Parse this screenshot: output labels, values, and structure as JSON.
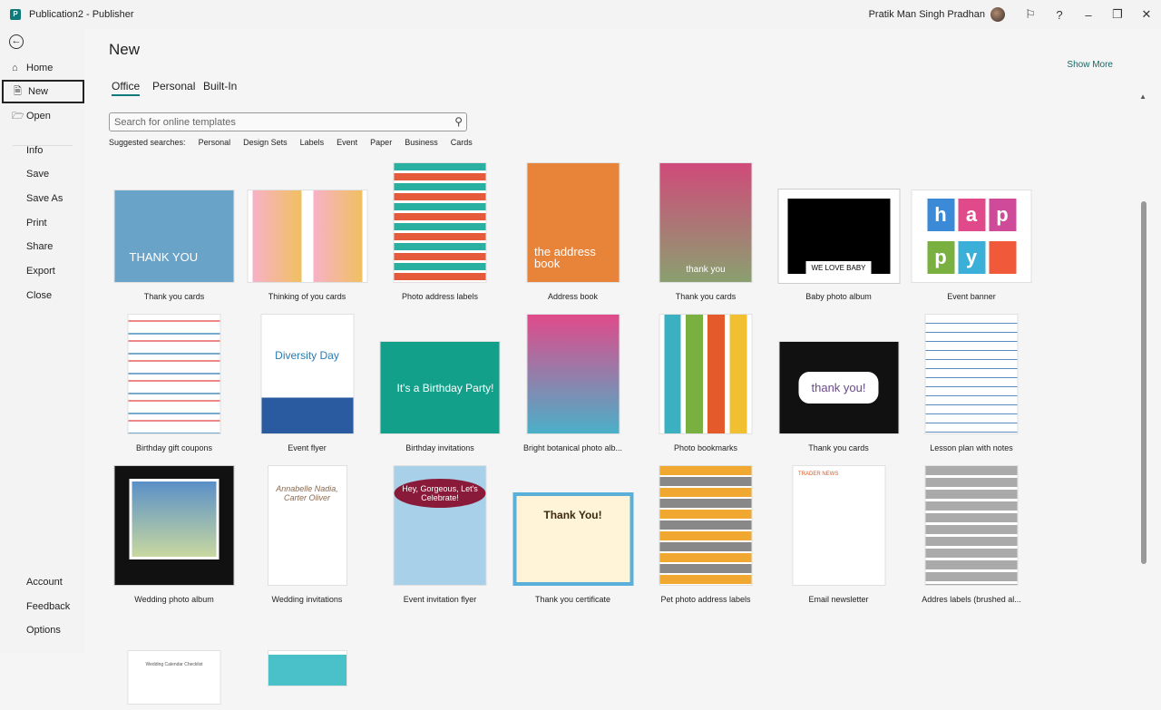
{
  "titlebar": {
    "app_title": "Publication2  -  Publisher",
    "user": "Pratik Man Singh Pradhan",
    "icon_letter": "P"
  },
  "sidebar": {
    "items": [
      {
        "label": "Home"
      },
      {
        "label": "New"
      },
      {
        "label": "Open"
      },
      {
        "label": "Info"
      },
      {
        "label": "Save"
      },
      {
        "label": "Save As"
      },
      {
        "label": "Print"
      },
      {
        "label": "Share"
      },
      {
        "label": "Export"
      },
      {
        "label": "Close"
      },
      {
        "label": "Account"
      },
      {
        "label": "Feedback"
      },
      {
        "label": "Options"
      }
    ]
  },
  "main": {
    "title": "New",
    "show_more": "Show More",
    "tabs": [
      "Office",
      "Personal",
      "Built-In"
    ],
    "search": {
      "placeholder": "Search for online templates"
    },
    "suggested_label": "Suggested searches:",
    "suggested": [
      "Personal",
      "Design Sets",
      "Labels",
      "Event",
      "Paper",
      "Business",
      "Cards"
    ],
    "templates": [
      {
        "label": "Thank you cards",
        "thumb_text": "THANK YOU"
      },
      {
        "label": "Thinking of you cards",
        "thumb_text": ""
      },
      {
        "label": "Photo address labels",
        "thumb_text": ""
      },
      {
        "label": "Address book",
        "thumb_text": "the address book"
      },
      {
        "label": "Thank you cards",
        "thumb_text": "thank you"
      },
      {
        "label": "Baby photo album",
        "thumb_text": "WE LOVE BABY"
      },
      {
        "label": "Event banner",
        "thumb_text": "happy"
      },
      {
        "label": "Birthday gift coupons",
        "thumb_text": ""
      },
      {
        "label": "Event flyer",
        "thumb_text": "Diversity Day"
      },
      {
        "label": "Birthday invitations",
        "thumb_text": "It's a Birthday Party!"
      },
      {
        "label": "Bright botanical photo alb...",
        "thumb_text": ""
      },
      {
        "label": "Photo bookmarks",
        "thumb_text": ""
      },
      {
        "label": "Thank you cards",
        "thumb_text": "thank you!"
      },
      {
        "label": "Lesson plan with notes",
        "thumb_text": ""
      },
      {
        "label": "Wedding photo album",
        "thumb_text": ""
      },
      {
        "label": "Wedding invitations",
        "thumb_text": "Annabelle Nadia, Carter Oliver"
      },
      {
        "label": "Event invitation flyer",
        "thumb_text": "Hey, Gorgeous, Let's Celebrate!"
      },
      {
        "label": "Thank you certificate",
        "thumb_text": "Thank You!"
      },
      {
        "label": "Pet photo address labels",
        "thumb_text": ""
      },
      {
        "label": "Email newsletter",
        "thumb_text": "TRADER NEWS"
      },
      {
        "label": "Addres labels (brushed al...",
        "thumb_text": ""
      },
      {
        "label": "",
        "thumb_text": "Wedding Calendar Checklist"
      },
      {
        "label": "",
        "thumb_text": ""
      }
    ]
  }
}
